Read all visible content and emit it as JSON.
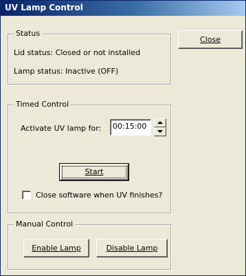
{
  "window": {
    "title": "UV Lamp Control"
  },
  "buttons": {
    "close_label": "Close",
    "start_label": "Start",
    "enable_label": "Enable Lamp",
    "disable_label": "Disable Lamp"
  },
  "status": {
    "group_label": "Status",
    "lid_status": "Lid status: Closed or not installed",
    "lamp_status": "Lamp status: Inactive (OFF)"
  },
  "timed": {
    "group_label": "Timed Control",
    "activate_label": "Activate UV lamp for:",
    "duration_value": "00:15:00",
    "close_on_finish_label": "Close software when UV finishes?",
    "close_on_finish_checked": false
  },
  "manual": {
    "group_label": "Manual Control"
  },
  "icons": {
    "spin_up": "up-arrow-icon",
    "spin_down": "down-arrow-icon"
  },
  "colors": {
    "title_start": "#0a246a",
    "title_end": "#a6caf0",
    "face": "#ece9d8"
  }
}
